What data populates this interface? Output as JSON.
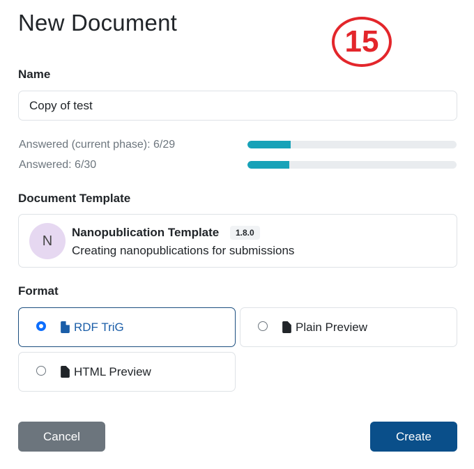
{
  "page": {
    "title": "New Document",
    "step_badge": "15"
  },
  "name_field": {
    "label": "Name",
    "value": "Copy of test"
  },
  "progress": {
    "current_phase_label": "Answered (current phase): 6/29",
    "current_phase_fraction": 0.207,
    "total_label": "Answered: 6/30",
    "total_fraction": 0.2
  },
  "template": {
    "label": "Document Template",
    "avatar_letter": "N",
    "name": "Nanopublication Template",
    "version": "1.8.0",
    "description": "Creating nanopublications for submissions"
  },
  "format": {
    "label": "Format",
    "options": [
      {
        "label": "RDF TriG",
        "selected": true,
        "icon": "file-icon"
      },
      {
        "label": "Plain Preview",
        "selected": false,
        "icon": "file-icon"
      },
      {
        "label": "HTML Preview",
        "selected": false,
        "icon": "file-icon"
      }
    ]
  },
  "buttons": {
    "cancel": "Cancel",
    "create": "Create"
  },
  "colors": {
    "progress": "#17a2b8",
    "primary": "#0a4f8a",
    "secondary": "#6c757d",
    "badge": "#e3262b"
  }
}
